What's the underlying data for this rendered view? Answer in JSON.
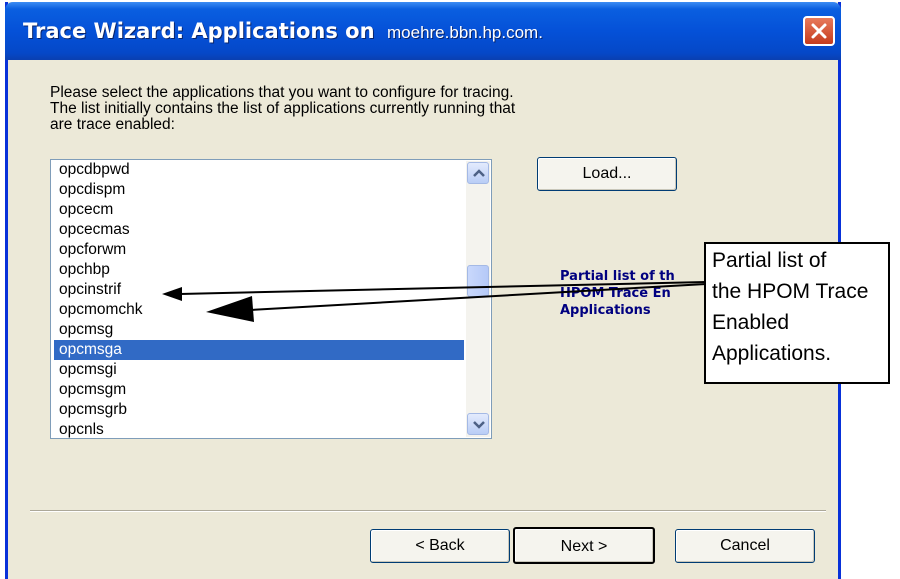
{
  "window": {
    "title": "Trace Wizard: Applications on",
    "host": "moehre.bbn.hp.com."
  },
  "intro": {
    "lines": [
      "Please select the applications that you want to configure for tracing.",
      "The list initially contains the list of applications currently running that",
      "are trace enabled:"
    ]
  },
  "app_list": {
    "items": [
      "opcdbpwd",
      "opcdispm",
      "opcecm",
      "opcecmas",
      "opcforwm",
      "opchbp",
      "opcinstrif",
      "opcmomchk",
      "opcmsg",
      "opcmsga",
      "opcmsgi",
      "opcmsgm",
      "opcmsgrb",
      "opcnls"
    ],
    "selected": "opcmsga"
  },
  "buttons": {
    "load": "Load...",
    "back": "< Back",
    "next": "Next >",
    "cancel": "Cancel"
  },
  "annotation_small": {
    "lines": [
      "Partial list of th",
      "HPOM Trace En",
      "Applications"
    ]
  },
  "callout": {
    "lines": [
      "Partial list of",
      "the HPOM Trace",
      "Enabled",
      "Applications."
    ]
  },
  "icons": {
    "close": "close-x-icon",
    "scroll_up": "chevron-up-icon",
    "scroll_down": "chevron-down-icon"
  },
  "colors": {
    "title_bar": "#0551d8",
    "selection": "#316ac5",
    "close_button": "#d4512e",
    "dialog_bg": "#ece9d8",
    "annotation_text": "#000080"
  }
}
